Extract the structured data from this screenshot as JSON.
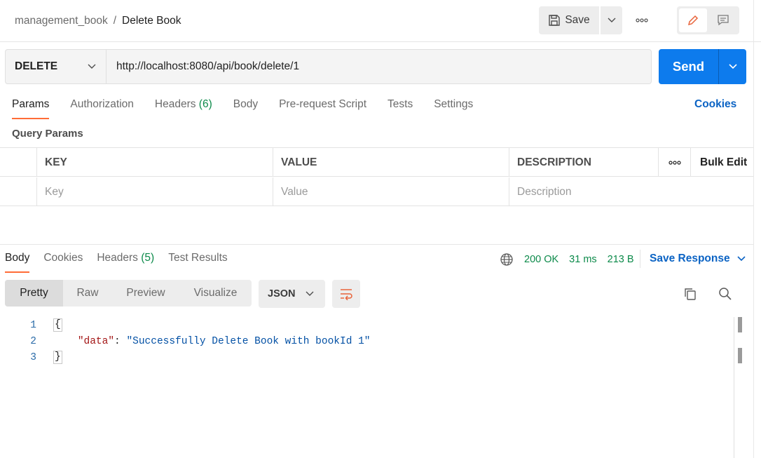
{
  "breadcrumb": {
    "collection": "management_book",
    "separator": "/",
    "request": "Delete Book"
  },
  "toolbar": {
    "save_label": "Save"
  },
  "request": {
    "method": "DELETE",
    "url": "http://localhost:8080/api/book/delete/1",
    "send_label": "Send"
  },
  "request_tabs": [
    {
      "label": "Params",
      "active": true
    },
    {
      "label": "Authorization"
    },
    {
      "label": "Headers",
      "count": "(6)"
    },
    {
      "label": "Body"
    },
    {
      "label": "Pre-request Script"
    },
    {
      "label": "Tests"
    },
    {
      "label": "Settings"
    }
  ],
  "cookies_link": "Cookies",
  "query_params": {
    "label": "Query Params",
    "columns": {
      "key": "KEY",
      "value": "VALUE",
      "description": "DESCRIPTION",
      "bulk_edit": "Bulk Edit"
    },
    "placeholders": {
      "key": "Key",
      "value": "Value",
      "description": "Description"
    }
  },
  "response_tabs": [
    {
      "label": "Body",
      "active": true
    },
    {
      "label": "Cookies"
    },
    {
      "label": "Headers",
      "count": "(5)"
    },
    {
      "label": "Test Results"
    }
  ],
  "response_meta": {
    "status": "200 OK",
    "time": "31 ms",
    "size": "213 B",
    "save_response": "Save Response"
  },
  "view_modes": [
    "Pretty",
    "Raw",
    "Preview",
    "Visualize"
  ],
  "format": "JSON",
  "code": {
    "line_numbers": [
      "1",
      "2",
      "3"
    ],
    "open_brace": "{",
    "key": "\"data\"",
    "colon": ": ",
    "value": "\"Successfully Delete Book with bookId 1\"",
    "close_brace": "}"
  },
  "colors": {
    "accent": "#ff6c37",
    "send": "#0d7bed",
    "link": "#0b63c4",
    "success": "#0c8a4a"
  }
}
